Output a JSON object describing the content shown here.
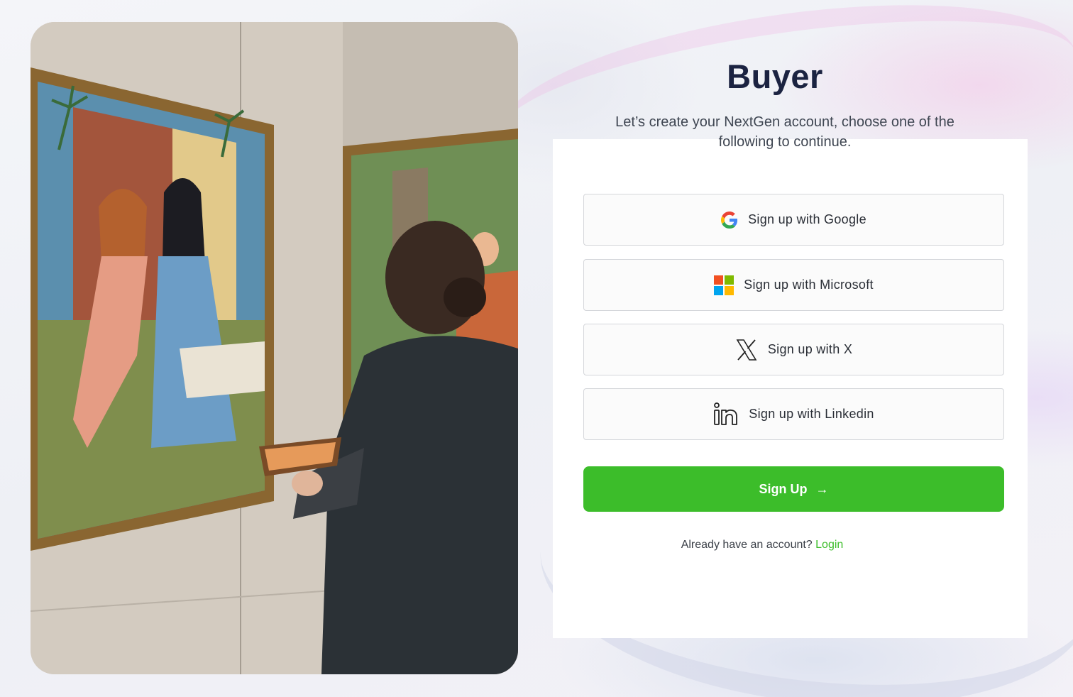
{
  "heading": "Buyer",
  "subtitle": "Let’s create your NextGen account, choose one of the following to continue.",
  "providers": [
    {
      "label": "Sign up with Google",
      "icon": "google-icon"
    },
    {
      "label": "Sign up with Microsoft",
      "icon": "microsoft-icon"
    },
    {
      "label": "Sign up with X",
      "icon": "x-icon"
    },
    {
      "label": "Sign up with Linkedin",
      "icon": "linkedin-icon"
    }
  ],
  "signup": {
    "label": "Sign Up",
    "icon": "arrow-right-icon"
  },
  "footer": {
    "prompt": "Already have an account?",
    "login_label": "Login"
  },
  "colors": {
    "accent": "#3cbd2a",
    "heading": "#1b2341",
    "google_blue": "#4285F4",
    "google_red": "#EA4335",
    "google_yellow": "#FBBC05",
    "google_green": "#34A853",
    "ms_red": "#F25022",
    "ms_green": "#7FBA00",
    "ms_blue": "#00A4EF",
    "ms_yellow": "#FFB900"
  }
}
